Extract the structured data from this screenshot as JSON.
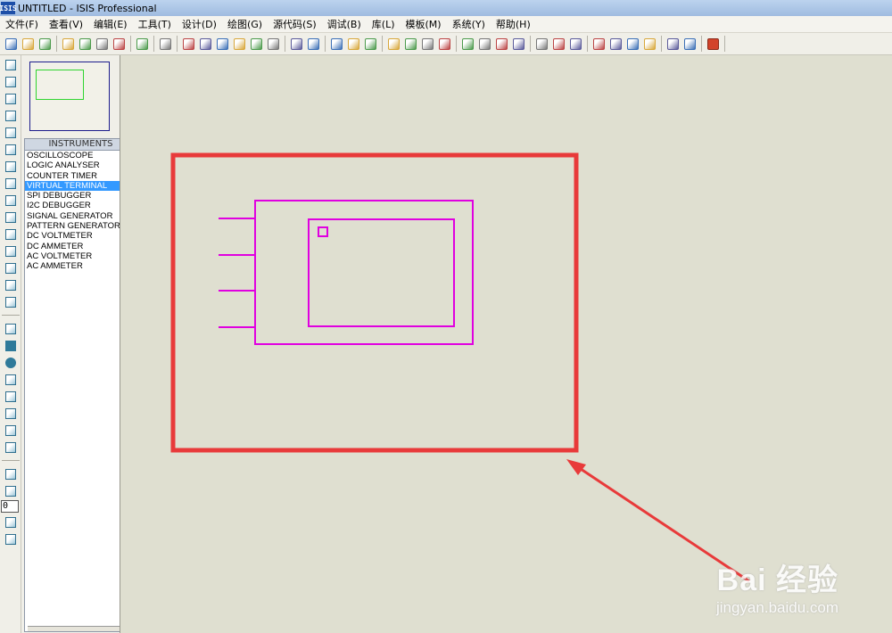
{
  "window": {
    "icon_text": "ISIS",
    "title": "UNTITLED - ISIS Professional"
  },
  "menu": [
    "文件(F)",
    "查看(V)",
    "编辑(E)",
    "工具(T)",
    "设计(D)",
    "绘图(G)",
    "源代码(S)",
    "调试(B)",
    "库(L)",
    "模板(M)",
    "系统(Y)",
    "帮助(H)"
  ],
  "toolbar": {
    "groups": [
      [
        "new-icon",
        "open-icon",
        "save-icon"
      ],
      [
        "import-icon",
        "export-icon",
        "print-icon",
        "print-area-icon"
      ],
      [
        "refresh-icon"
      ],
      [
        "grid-icon"
      ],
      [
        "origin-icon",
        "pan-icon",
        "zoom-in-icon",
        "zoom-out-icon",
        "zoom-all-icon",
        "zoom-area-icon"
      ],
      [
        "undo-icon",
        "redo-icon"
      ],
      [
        "cut-icon",
        "copy-icon",
        "paste-icon"
      ],
      [
        "block-copy-icon",
        "block-move-icon",
        "block-rotate-icon",
        "block-delete-icon"
      ],
      [
        "pick-device-icon",
        "make-device-icon",
        "package-icon",
        "decompose-icon"
      ],
      [
        "wire-autorouter-icon",
        "search-tag-icon",
        "property-assign-icon"
      ],
      [
        "new-sheet-icon",
        "delete-sheet-icon",
        "netlist-icon",
        "bom-icon"
      ],
      [
        "electrical-check-icon",
        "netlist-ares-icon"
      ],
      [
        "ares-icon"
      ]
    ]
  },
  "left_tools": {
    "group1": [
      "select-mode-icon",
      "component-mode-icon",
      "junction-icon",
      "wire-label-icon",
      "text-script-icon",
      "bus-icon",
      "subcircuit-icon",
      "terminal-icon",
      "device-pin-icon",
      "graph-icon",
      "tape-recorder-icon",
      "generator-icon",
      "voltage-probe-icon",
      "current-probe-icon",
      "virtual-instrument-icon"
    ],
    "group2": [
      "line-icon",
      "box-icon",
      "circle-icon",
      "arc-icon",
      "path-icon",
      "text-icon",
      "symbol-icon",
      "marker-icon"
    ],
    "rotate_value": "0"
  },
  "instruments": {
    "header": "INSTRUMENTS",
    "items": [
      "OSCILLOSCOPE",
      "LOGIC ANALYSER",
      "COUNTER TIMER",
      "VIRTUAL TERMINAL",
      "SPI DEBUGGER",
      "I2C DEBUGGER",
      "SIGNAL GENERATOR",
      "PATTERN GENERATOR",
      "DC VOLTMETER",
      "DC AMMETER",
      "AC VOLTMETER",
      "AC AMMETER"
    ],
    "selected": "VIRTUAL TERMINAL"
  },
  "colors": {
    "component_outline": "#e000e0",
    "highlight_box": "#e83a3a",
    "overview_border": "#1c1c8c",
    "overview_rect": "#2fd42f",
    "selection": "#3399ff"
  },
  "watermark": {
    "logo": "Bai 经验",
    "url": "jingyan.baidu.com"
  }
}
